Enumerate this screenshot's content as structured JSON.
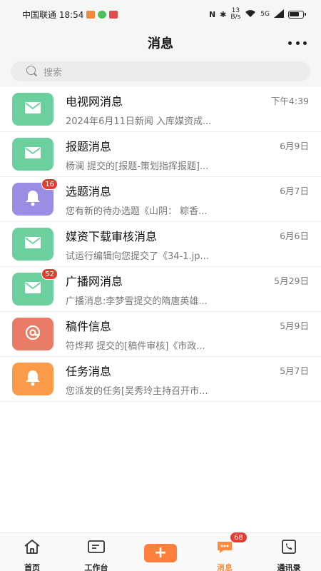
{
  "status_bar": {
    "carrier_time": "中国联通 18:54",
    "network_speed_top": "13",
    "network_speed_unit": "B/s",
    "signal_label": "5G"
  },
  "header": {
    "title": "消息"
  },
  "search": {
    "placeholder": "搜索"
  },
  "messages": [
    {
      "name": "电视网消息",
      "preview": "2024年6月11日新闻 入库媒资成...",
      "time": "下午4:39",
      "icon": "mail-icon",
      "color": "#6bcf9e",
      "badge": ""
    },
    {
      "name": "报题消息",
      "preview": "杨澜 提交的[报题-策划指挥报题]...",
      "time": "6月9日",
      "icon": "mail-icon",
      "color": "#6bcf9e",
      "badge": ""
    },
    {
      "name": "选题消息",
      "preview": "您有新的待办选题《山阴： 粽香...",
      "time": "6月7日",
      "icon": "bell-icon",
      "color": "#9a8de4",
      "badge": "16"
    },
    {
      "name": "媒资下载审核消息",
      "preview": "试运行编辑向您提交了《34-1.jp...",
      "time": "6月6日",
      "icon": "mail-icon",
      "color": "#6bcf9e",
      "badge": ""
    },
    {
      "name": "广播网消息",
      "preview": "广播消息:李梦雪提交的隋唐英雄...",
      "time": "5月29日",
      "icon": "mail-icon",
      "color": "#6bcf9e",
      "badge": "52"
    },
    {
      "name": "稿件信息",
      "preview": "符烨邦 提交的[稿件审核]《市政...",
      "time": "5月9日",
      "icon": "at-icon",
      "color": "#ea7c67",
      "badge": ""
    },
    {
      "name": "任务消息",
      "preview": "您派发的任务[吴秀玲主持召开市...",
      "time": "5月7日",
      "icon": "bell-icon",
      "color": "#fb9a48",
      "badge": ""
    }
  ],
  "tabbar": {
    "home": "首页",
    "workbench": "工作台",
    "plus": "+",
    "messages": "消息",
    "messages_badge": "68",
    "contacts": "通讯录",
    "active_color": "#ff8a3d"
  }
}
